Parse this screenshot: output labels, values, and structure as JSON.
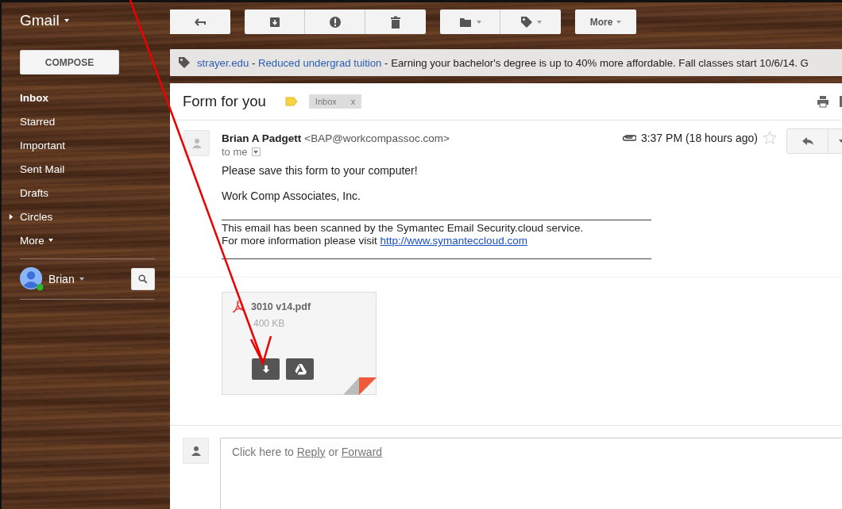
{
  "app": {
    "name": "Gmail"
  },
  "compose": "COMPOSE",
  "folders": [
    {
      "label": "Inbox",
      "kind": "folder",
      "selected": true
    },
    {
      "label": "Starred",
      "kind": "folder",
      "selected": false
    },
    {
      "label": "Important",
      "kind": "folder",
      "selected": false
    },
    {
      "label": "Sent Mail",
      "kind": "folder",
      "selected": false
    },
    {
      "label": "Drafts",
      "kind": "folder",
      "selected": false
    },
    {
      "label": "Circles",
      "kind": "group",
      "selected": false,
      "expanded": false
    },
    {
      "label": "More",
      "kind": "menu",
      "selected": false
    }
  ],
  "account": {
    "name": "Brian",
    "online": true
  },
  "toolbar": {
    "more": "More"
  },
  "ad": [
    {
      "kind": "link",
      "text": "strayer.edu"
    },
    {
      "kind": "plain",
      "text": " - "
    },
    {
      "kind": "link",
      "text": "Reduced undergrad tuition"
    },
    {
      "kind": "plain",
      "text": " - Earning your bachelor's degree is up to 40% more affordable. Fall classes start 10/6/14. G"
    }
  ],
  "thread": {
    "subject": "Form for you",
    "important": true,
    "label": {
      "text": "Inbox",
      "remove": "x"
    }
  },
  "message": {
    "sender": "Brian A Padgett",
    "email": "<BAP@workcompassoc.com>",
    "recipient": "to me",
    "time": "3:37 PM (18 hours ago)",
    "starred": false,
    "has_attachment": true,
    "body": [
      "Please save this form to your computer!",
      "Work Comp Associates, Inc."
    ],
    "footer": {
      "line1": "This email has been scanned by the Symantec Email Security.cloud service.",
      "line2": "For more information please visit ",
      "link": "http://www.symanteccloud.com"
    }
  },
  "attachment": {
    "name": "3010 v14.pdf",
    "size": "400 KB"
  },
  "reply_box": {
    "prefix": "Click here to ",
    "reply": "Reply",
    "middle": " or ",
    "forward": "Forward"
  }
}
